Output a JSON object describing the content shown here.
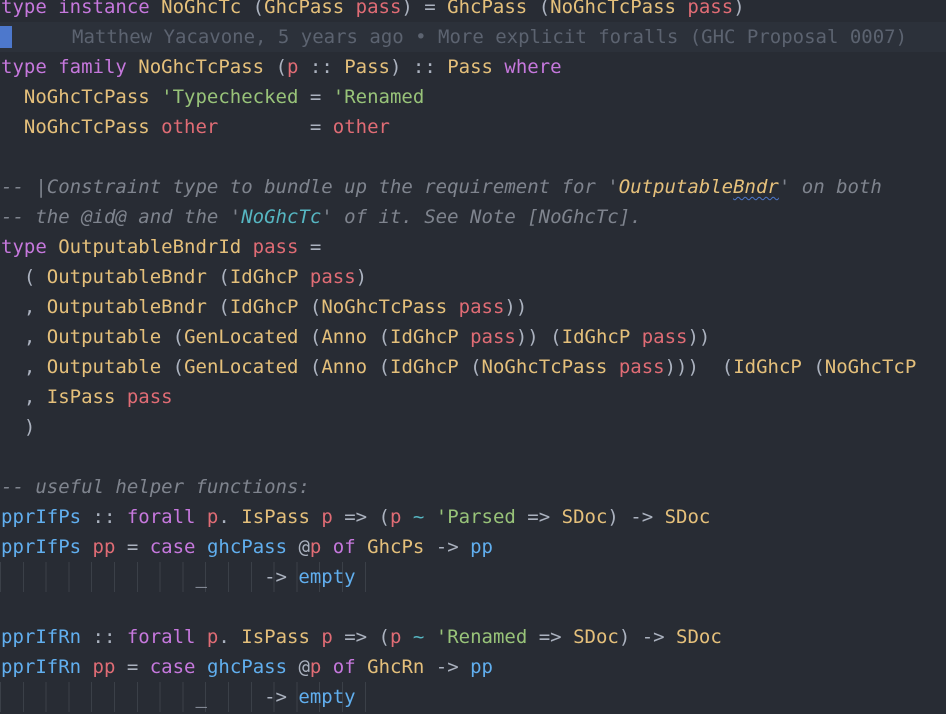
{
  "editor": {
    "language": "Haskell",
    "blame": "Matthew Yacavone, 5 years ago • More explicit foralls (GHC Proposal 0007)",
    "colors": {
      "background": "#282c34",
      "keyword": "#c678dd",
      "type": "#e5c07b",
      "function": "#61afef",
      "variable": "#e06c75",
      "operator": "#56b6c2",
      "comment": "#7f848e",
      "cursor": "#4d78cc"
    },
    "lines": [
      [
        [
          "kw",
          "type instance "
        ],
        [
          "ty",
          "NoGhcTc "
        ],
        [
          "plain",
          "("
        ],
        [
          "ty",
          "GhcPass "
        ],
        [
          "var",
          "pass"
        ],
        [
          "plain",
          ") = "
        ],
        [
          "ty",
          "GhcPass "
        ],
        [
          "plain",
          "("
        ],
        [
          "ty",
          "NoGhcTcPass "
        ],
        [
          "var",
          "pass"
        ],
        [
          "plain",
          ")"
        ]
      ],
      [],
      [
        [
          "kw",
          "type family "
        ],
        [
          "ty",
          "NoGhcTcPass "
        ],
        [
          "plain",
          "("
        ],
        [
          "var",
          "p"
        ],
        [
          "plain",
          " :: "
        ],
        [
          "ty",
          "Pass"
        ],
        [
          "plain",
          ") :: "
        ],
        [
          "ty",
          "Pass "
        ],
        [
          "kw",
          "where"
        ]
      ],
      [
        [
          "plain",
          "  "
        ],
        [
          "ty",
          "NoGhcTcPass "
        ],
        [
          "str",
          "'Typechecked"
        ],
        [
          "plain",
          " = "
        ],
        [
          "str",
          "'Renamed"
        ]
      ],
      [
        [
          "plain",
          "  "
        ],
        [
          "ty",
          "NoGhcTcPass "
        ],
        [
          "var",
          "other"
        ],
        [
          "plain",
          "        = "
        ],
        [
          "var",
          "other"
        ]
      ],
      [],
      [
        [
          "cmt",
          "-- |Constraint type to bundle up the requirement for '"
        ],
        [
          "cmt-hl",
          "Outputable"
        ],
        [
          "cmt-hl squiggle",
          "Bndr"
        ],
        [
          "cmt",
          "' on both"
        ]
      ],
      [
        [
          "cmt",
          "-- the @id@ and the '"
        ],
        [
          "cmt-hl2",
          "NoGhcTc"
        ],
        [
          "cmt",
          "' of it. See Note [NoGhcTc]."
        ]
      ],
      [
        [
          "kw",
          "type "
        ],
        [
          "ty",
          "OutputableBndrId "
        ],
        [
          "var",
          "pass"
        ],
        [
          "plain",
          " ="
        ]
      ],
      [
        [
          "plain",
          "  ( "
        ],
        [
          "ty",
          "OutputableBndr "
        ],
        [
          "plain",
          "("
        ],
        [
          "ty",
          "IdGhcP "
        ],
        [
          "var",
          "pass"
        ],
        [
          "plain",
          ")"
        ]
      ],
      [
        [
          "plain",
          "  , "
        ],
        [
          "ty",
          "OutputableBndr "
        ],
        [
          "plain",
          "("
        ],
        [
          "ty",
          "IdGhcP "
        ],
        [
          "plain",
          "("
        ],
        [
          "ty",
          "NoGhcTcPass "
        ],
        [
          "var",
          "pass"
        ],
        [
          "plain",
          "))"
        ]
      ],
      [
        [
          "plain",
          "  , "
        ],
        [
          "ty",
          "Outputable "
        ],
        [
          "plain",
          "("
        ],
        [
          "ty",
          "GenLocated "
        ],
        [
          "plain",
          "("
        ],
        [
          "ty",
          "Anno "
        ],
        [
          "plain",
          "("
        ],
        [
          "ty",
          "IdGhcP "
        ],
        [
          "var",
          "pass"
        ],
        [
          "plain",
          ")) ("
        ],
        [
          "ty",
          "IdGhcP "
        ],
        [
          "var",
          "pass"
        ],
        [
          "plain",
          "))"
        ]
      ],
      [
        [
          "plain",
          "  , "
        ],
        [
          "ty",
          "Outputable "
        ],
        [
          "plain",
          "("
        ],
        [
          "ty",
          "GenLocated "
        ],
        [
          "plain",
          "("
        ],
        [
          "ty",
          "Anno "
        ],
        [
          "plain",
          "("
        ],
        [
          "ty",
          "IdGhcP "
        ],
        [
          "plain",
          "("
        ],
        [
          "ty",
          "NoGhcTcPass "
        ],
        [
          "var",
          "pass"
        ],
        [
          "plain",
          ")))  ("
        ],
        [
          "ty",
          "IdGhcP "
        ],
        [
          "plain",
          "("
        ],
        [
          "ty",
          "NoGhcTcP"
        ]
      ],
      [
        [
          "plain",
          "  , "
        ],
        [
          "ty",
          "IsPass "
        ],
        [
          "var",
          "pass"
        ]
      ],
      [
        [
          "plain",
          "  )"
        ]
      ],
      [],
      [
        [
          "cmt",
          "-- useful helper functions:"
        ]
      ],
      [
        [
          "fn",
          "pprIfPs"
        ],
        [
          "plain",
          " :: "
        ],
        [
          "kw",
          "forall "
        ],
        [
          "var",
          "p"
        ],
        [
          "plain",
          ". "
        ],
        [
          "ty",
          "IsPass "
        ],
        [
          "var",
          "p"
        ],
        [
          "plain",
          " => ("
        ],
        [
          "var",
          "p"
        ],
        [
          "op",
          " ~ "
        ],
        [
          "str",
          "'Parsed"
        ],
        [
          "plain",
          " => "
        ],
        [
          "ty",
          "SDoc"
        ],
        [
          "plain",
          ") -> "
        ],
        [
          "ty",
          "SDoc"
        ]
      ],
      [
        [
          "fn",
          "pprIfPs "
        ],
        [
          "var",
          "pp"
        ],
        [
          "plain",
          " = "
        ],
        [
          "kw",
          "case "
        ],
        [
          "fn",
          "ghcPass "
        ],
        [
          "plain",
          "@"
        ],
        [
          "var",
          "p"
        ],
        [
          "kw",
          " of "
        ],
        [
          "ty",
          "GhcPs"
        ],
        [
          "plain",
          " -> "
        ],
        [
          "fn",
          "pp"
        ]
      ],
      [
        [
          "plain",
          "                 _     -> "
        ],
        [
          "fn",
          "empty"
        ]
      ],
      [],
      [
        [
          "fn",
          "pprIfRn"
        ],
        [
          "plain",
          " :: "
        ],
        [
          "kw",
          "forall "
        ],
        [
          "var",
          "p"
        ],
        [
          "plain",
          ". "
        ],
        [
          "ty",
          "IsPass "
        ],
        [
          "var",
          "p"
        ],
        [
          "plain",
          " => ("
        ],
        [
          "var",
          "p"
        ],
        [
          "op",
          " ~ "
        ],
        [
          "str",
          "'Renamed"
        ],
        [
          "plain",
          " => "
        ],
        [
          "ty",
          "SDoc"
        ],
        [
          "plain",
          ") -> "
        ],
        [
          "ty",
          "SDoc"
        ]
      ],
      [
        [
          "fn",
          "pprIfRn "
        ],
        [
          "var",
          "pp"
        ],
        [
          "plain",
          " = "
        ],
        [
          "kw",
          "case "
        ],
        [
          "fn",
          "ghcPass "
        ],
        [
          "plain",
          "@"
        ],
        [
          "var",
          "p"
        ],
        [
          "kw",
          " of "
        ],
        [
          "ty",
          "GhcRn"
        ],
        [
          "plain",
          " -> "
        ],
        [
          "fn",
          "pp"
        ]
      ],
      [
        [
          "plain",
          "                 _     -> "
        ],
        [
          "fn",
          "empty"
        ]
      ]
    ]
  }
}
